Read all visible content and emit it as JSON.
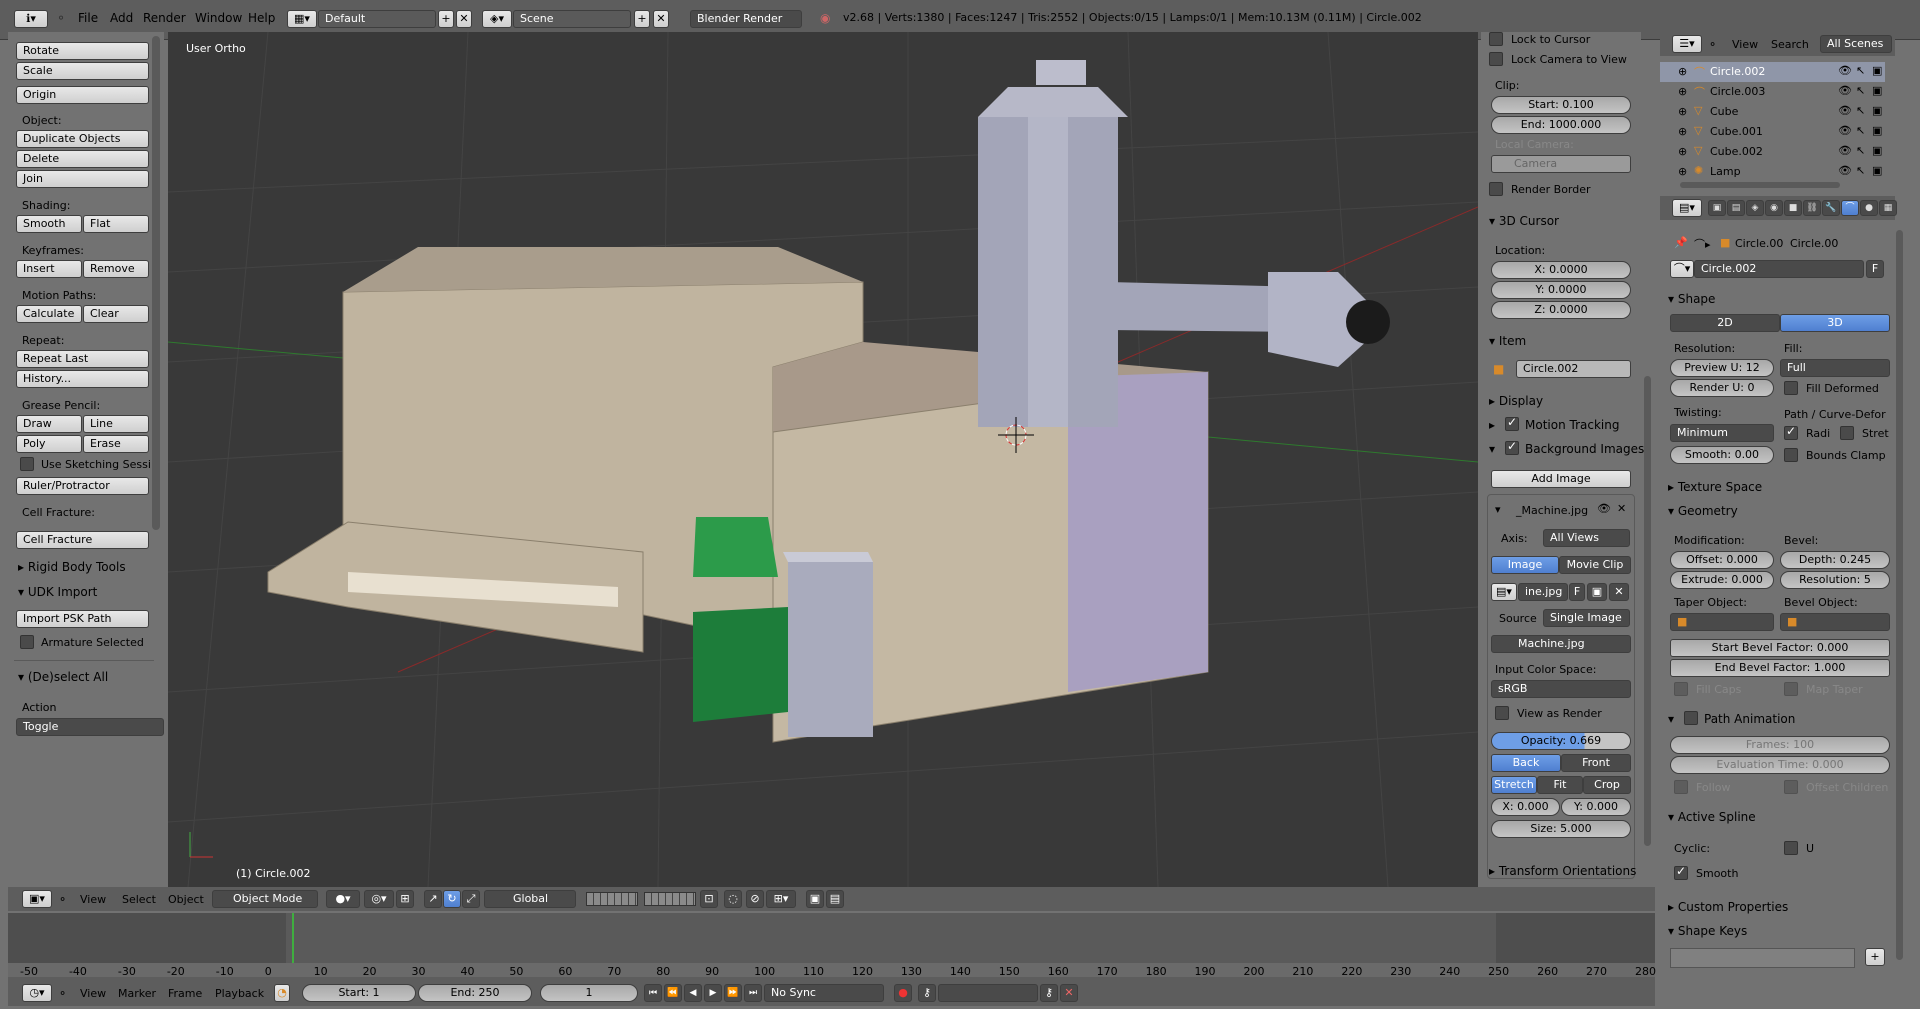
{
  "topbar": {
    "menu": [
      "File",
      "Add",
      "Render",
      "Window",
      "Help"
    ],
    "layout": "Default",
    "scene": "Scene",
    "engine": "Blender Render",
    "stats": "v2.68 | Verts:1380 | Faces:1247 | Tris:2552 | Objects:0/15 | Lamps:0/1 | Mem:10.13M (0.11M) | Circle.002"
  },
  "toolshelf": {
    "transform": [
      "Rotate",
      "Scale"
    ],
    "origin": "Origin",
    "object_label": "Object:",
    "object_buttons": [
      "Duplicate Objects",
      "Delete",
      "Join"
    ],
    "shading_label": "Shading:",
    "shading": [
      "Smooth",
      "Flat"
    ],
    "keyframes_label": "Keyframes:",
    "keyframes": [
      "Insert",
      "Remove"
    ],
    "motion_label": "Motion Paths:",
    "motion": [
      "Calculate",
      "Clear"
    ],
    "repeat_label": "Repeat:",
    "repeat": [
      "Repeat Last",
      "History..."
    ],
    "grease_label": "Grease Pencil:",
    "grease_row1": [
      "Draw",
      "Line"
    ],
    "grease_row2": [
      "Poly",
      "Erase"
    ],
    "use_sketching": "Use Sketching Sessi",
    "ruler": "Ruler/Protractor",
    "cell_label": "Cell Fracture:",
    "cell_button": "Cell Fracture",
    "rigid": "Rigid Body Tools",
    "udk": "UDK Import",
    "import_psk": "Import PSK Path",
    "armature": "Armature Selected",
    "deselect": "(De)select All",
    "action_label": "Action",
    "action_value": "Toggle"
  },
  "viewport": {
    "view_label": "User Ortho",
    "object_label": "(1) Circle.002"
  },
  "nprops": {
    "lock_cursor": "Lock to Cursor",
    "lock_camera": "Lock Camera to View",
    "clip_label": "Clip:",
    "clip_start": "Start: 0.100",
    "clip_end": "End: 1000.000",
    "local_camera": "Local Camera:",
    "camera": "Camera",
    "render_border": "Render Border",
    "cursor_header": "3D Cursor",
    "location_label": "Location:",
    "x": "X: 0.0000",
    "y": "Y: 0.0000",
    "z": "Z: 0.0000",
    "item_header": "Item",
    "item_name": "Circle.002",
    "display": "Display",
    "motion_tracking": "Motion Tracking",
    "bg_images": "Background Images",
    "add_image": "Add Image",
    "image_name": "_Machine.jpg",
    "axis_label": "Axis:",
    "axis_value": "All Views",
    "tab_image": "Image",
    "tab_movie": "Movie Clip",
    "img_file": "ine.jpg",
    "img_f": "F",
    "source_label": "Source",
    "source_value": "Single Image",
    "machine": "Machine.jpg",
    "color_space_label": "Input Color Space:",
    "color_space": "sRGB",
    "view_as_render": "View as Render",
    "opacity": "Opacity: 0.669",
    "back": "Back",
    "front": "Front",
    "stretch": "Stretch",
    "fit": "Fit",
    "crop": "Crop",
    "bx": "X: 0.000",
    "by": "Y: 0.000",
    "size": "Size: 5.000",
    "transform_orient": "Transform Orientations"
  },
  "outliner": {
    "view": "View",
    "search": "Search",
    "scenes": "All Scenes",
    "items": [
      "Circle.002",
      "Circle.003",
      "Cube",
      "Cube.001",
      "Cube.002",
      "Lamp"
    ]
  },
  "properties": {
    "crumb1": "Circle.00",
    "crumb2": "Circle.00",
    "datablock": "Circle.002",
    "f": "F",
    "shape": "Shape",
    "d2": "2D",
    "d3": "3D",
    "resolution": "Resolution:",
    "fill_label": "Fill:",
    "preview_u": "Preview U: 12",
    "fill_value": "Full",
    "render_u": "Render U: 0",
    "fill_deformed": "Fill Deformed",
    "twisting": "Twisting:",
    "path_curve": "Path / Curve-Defor",
    "twist_value": "Minimum",
    "radi": "Radi",
    "stret": "Stret",
    "smooth": "Smooth: 0.00",
    "bounds_clamp": "Bounds Clamp",
    "texture_space": "Texture Space",
    "geometry": "Geometry",
    "modification": "Modification:",
    "bevel": "Bevel:",
    "offset": "Offset: 0.000",
    "depth": "Depth: 0.245",
    "extrude": "Extrude: 0.000",
    "bevel_res": "Resolution: 5",
    "taper": "Taper Object:",
    "bevel_obj": "Bevel Object:",
    "start_bevel": "Start Bevel Factor: 0.000",
    "end_bevel": "End Bevel Factor: 1.000",
    "fill_caps": "Fill Caps",
    "map_taper": "Map Taper",
    "path_anim": "Path Animation",
    "frames": "Frames: 100",
    "eval_time": "Evaluation Time: 0.000",
    "follow": "Follow",
    "offset_children": "Offset Children",
    "active_spline": "Active Spline",
    "cyclic": "Cyclic:",
    "u": "U",
    "smooth_cb": "Smooth",
    "custom_props": "Custom Properties",
    "shape_keys": "Shape Keys"
  },
  "viewheader": {
    "view": "View",
    "select": "Select",
    "object": "Object",
    "mode": "Object Mode",
    "orientation": "Global"
  },
  "timeline": {
    "ticks": [
      "-50",
      "-40",
      "-30",
      "-20",
      "-10",
      "0",
      "10",
      "20",
      "30",
      "40",
      "50",
      "60",
      "70",
      "80",
      "90",
      "100",
      "110",
      "120",
      "130",
      "140",
      "150",
      "160",
      "170",
      "180",
      "190",
      "200",
      "210",
      "220",
      "230",
      "240",
      "250",
      "260",
      "270",
      "280"
    ],
    "view": "View",
    "marker": "Marker",
    "frame": "Frame",
    "playback": "Playback",
    "start": "Start: 1",
    "end": "End: 250",
    "current": "1",
    "sync": "No Sync"
  }
}
